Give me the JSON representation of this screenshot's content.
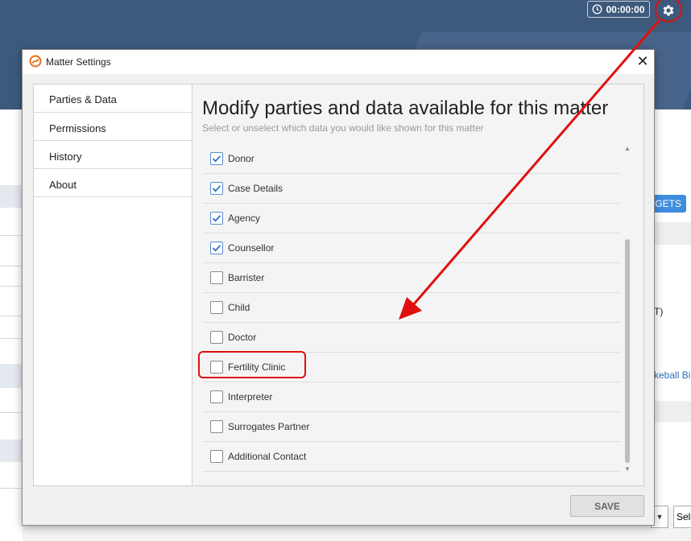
{
  "app": {
    "timer": "00:00:00",
    "right_button_label": "GETS",
    "right_text": "T)",
    "right_link": "keball Bi",
    "bottom_select": "Sell"
  },
  "dialog": {
    "title": "Matter Settings",
    "close_glyph": "✕",
    "nav": [
      "Parties & Data",
      "Permissions",
      "History",
      "About"
    ],
    "heading": "Modify parties and data available for this matter",
    "subheading": "Select or unselect which data you would like shown for this matter",
    "items": [
      {
        "label": "Donor",
        "checked": true
      },
      {
        "label": "Case Details",
        "checked": true
      },
      {
        "label": "Agency",
        "checked": true
      },
      {
        "label": "Counsellor",
        "checked": true
      },
      {
        "label": "Barrister",
        "checked": false
      },
      {
        "label": "Child",
        "checked": false
      },
      {
        "label": "Doctor",
        "checked": false
      },
      {
        "label": "Fertility Clinic",
        "checked": false
      },
      {
        "label": "Interpreter",
        "checked": false
      },
      {
        "label": "Surrogates Partner",
        "checked": false
      },
      {
        "label": "Additional Contact",
        "checked": false
      }
    ],
    "save_label": "SAVE"
  },
  "colors": {
    "header": "#3d5a7d",
    "accent": "#3f8de0",
    "annotation": "#e01010",
    "check": "#2f6fc4"
  }
}
